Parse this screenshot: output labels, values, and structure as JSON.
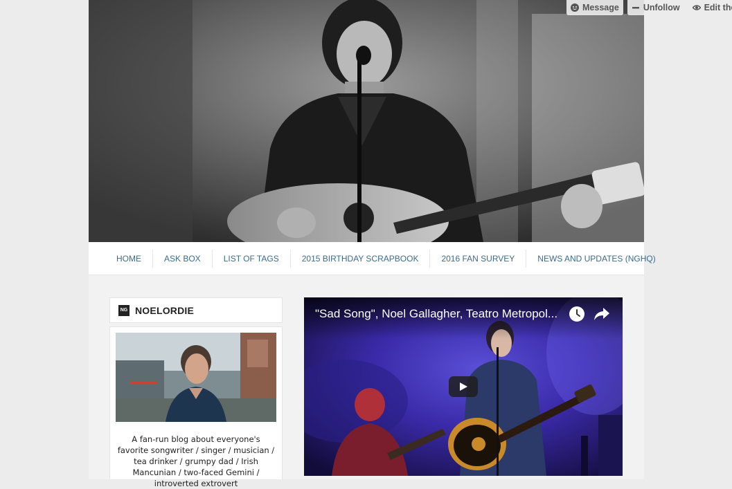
{
  "tumblr_controls": {
    "message": "Message",
    "unfollow": "Unfollow",
    "edit_theme": "Edit them"
  },
  "nav": {
    "items": [
      {
        "label": "HOME"
      },
      {
        "label": "ASK BOX"
      },
      {
        "label": "LIST OF TAGS"
      },
      {
        "label": "2015 BIRTHDAY SCRAPBOOK"
      },
      {
        "label": "2016 FAN SURVEY"
      },
      {
        "label": "NEWS AND UPDATES (NGHQ)"
      }
    ]
  },
  "sidebar": {
    "blog_icon_text": "NG",
    "blog_name": "NOELORDIE",
    "description": "A fan-run blog about everyone's favorite songwriter / singer / musician / tea drinker / grumpy dad / Irish Mancunian / two-faced Gemini / introverted extrovert"
  },
  "video": {
    "title": "\"Sad Song\", Noel Gallagher, Teatro Metropol..."
  },
  "icons": {
    "message": "message-icon",
    "unfollow": "minus-icon",
    "edit": "eye-icon",
    "watch_later": "clock-icon",
    "share": "share-icon",
    "play": "play-icon"
  }
}
